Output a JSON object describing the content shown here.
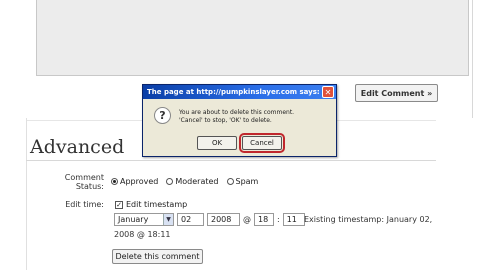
{
  "editor": {
    "edit_comment_button": "Edit Comment »"
  },
  "advanced": {
    "heading": "Advanced",
    "comment_status_label_line1": "Comment",
    "comment_status_label_line2": "Status:",
    "status_options": [
      {
        "label": "Approved",
        "selected": true
      },
      {
        "label": "Moderated",
        "selected": false
      },
      {
        "label": "Spam",
        "selected": false
      }
    ],
    "edit_time_label": "Edit time:",
    "edit_timestamp_label": "Edit timestamp",
    "edit_timestamp_checked": true,
    "month_value": "January",
    "day_value": "02",
    "year_value": "2008",
    "at_sep": "@",
    "hour_value": "18",
    "colon_sep": ":",
    "minute_value": "11",
    "existing_timestamp_line1": "Existing timestamp: January 02,",
    "existing_timestamp_line2": "2008 @ 18:11",
    "delete_button": "Delete this comment"
  },
  "dialog": {
    "title": "The page at http://pumpkinslayer.com says:",
    "close_glyph": "✕",
    "message_line1": "You are about to delete this comment.",
    "message_line2": "'Cancel' to stop, 'OK' to delete.",
    "icon_glyph": "?",
    "ok_label": "OK",
    "cancel_label": "Cancel",
    "titlebar_color": "#0a3ea6",
    "highlight_color": "#c0272d"
  }
}
